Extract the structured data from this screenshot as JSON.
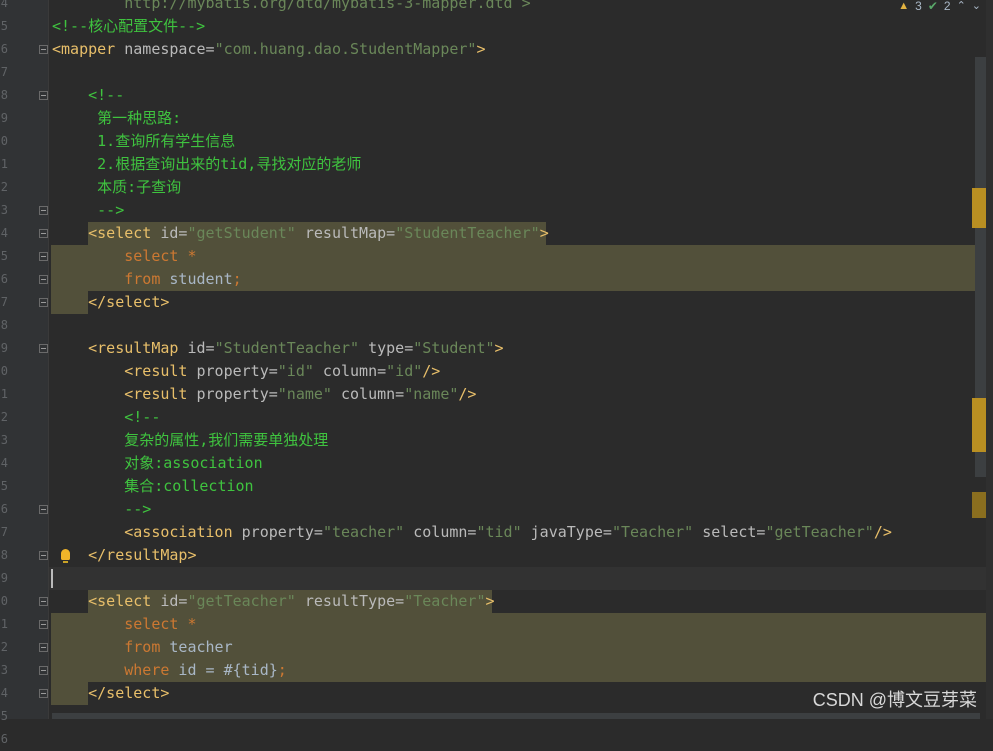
{
  "inspections": {
    "warnings": "3",
    "ok": "2",
    "warning_icon": "warning-triangle-icon",
    "ok_icon": "double-check-icon"
  },
  "line_numbers": [
    "4",
    "5",
    "6",
    "7",
    "8",
    "9",
    "0",
    "1",
    "2",
    "3",
    "4",
    "5",
    "6",
    "7",
    "8",
    "9",
    "0",
    "1",
    "2",
    "3",
    "4",
    "5",
    "6",
    "7",
    "8",
    "9",
    "0",
    "1",
    "2",
    "3",
    "4",
    "5",
    "6"
  ],
  "lines": [
    [
      {
        "t": "url",
        "v": "        http://mybatis.org/dtd/mybatis-3-mapper.dtd >"
      }
    ],
    [
      {
        "t": "comment",
        "v": "<!--核心配置文件-->"
      }
    ],
    [
      {
        "t": "tag",
        "v": "<mapper"
      },
      {
        "t": "attr",
        "v": " namespace="
      },
      {
        "t": "val",
        "v": "\"com.huang.dao.StudentMapper\""
      },
      {
        "t": "tag",
        "v": ">"
      }
    ],
    [],
    [
      {
        "t": "comment",
        "v": "    <!--"
      }
    ],
    [
      {
        "t": "comment",
        "v": "     第一种思路:"
      }
    ],
    [
      {
        "t": "comment",
        "v": "     1.查询所有学生信息"
      }
    ],
    [
      {
        "t": "comment",
        "v": "     2.根据查询出来的tid,寻找对应的老师"
      }
    ],
    [
      {
        "t": "comment",
        "v": "     本质:子查询"
      }
    ],
    [
      {
        "t": "comment",
        "v": "     -->"
      }
    ],
    [
      {
        "t": "tag",
        "v": "    <select"
      },
      {
        "t": "attr",
        "v": " id="
      },
      {
        "t": "val",
        "v": "\"getStudent\""
      },
      {
        "t": "attr",
        "v": " resultMap="
      },
      {
        "t": "val",
        "v": "\"StudentTeacher\""
      },
      {
        "t": "tag",
        "v": ">"
      }
    ],
    [
      {
        "t": "kw",
        "v": "        select"
      },
      {
        "t": "plain",
        "v": " "
      },
      {
        "t": "kw",
        "v": "*"
      }
    ],
    [
      {
        "t": "kw",
        "v": "        from"
      },
      {
        "t": "plain",
        "v": " student"
      },
      {
        "t": "kw",
        "v": ";"
      }
    ],
    [
      {
        "t": "tag",
        "v": "    </select>"
      }
    ],
    [],
    [
      {
        "t": "tag",
        "v": "    <resultMap"
      },
      {
        "t": "attr",
        "v": " id="
      },
      {
        "t": "val",
        "v": "\"StudentTeacher\""
      },
      {
        "t": "attr",
        "v": " type="
      },
      {
        "t": "val",
        "v": "\"Student\""
      },
      {
        "t": "tag",
        "v": ">"
      }
    ],
    [
      {
        "t": "tag",
        "v": "        <result"
      },
      {
        "t": "attr",
        "v": " property="
      },
      {
        "t": "val",
        "v": "\"id\""
      },
      {
        "t": "attr",
        "v": " column="
      },
      {
        "t": "val",
        "v": "\"id\""
      },
      {
        "t": "tag",
        "v": "/>"
      }
    ],
    [
      {
        "t": "tag",
        "v": "        <result"
      },
      {
        "t": "attr",
        "v": " property="
      },
      {
        "t": "val",
        "v": "\"name\""
      },
      {
        "t": "attr",
        "v": " column="
      },
      {
        "t": "val",
        "v": "\"name\""
      },
      {
        "t": "tag",
        "v": "/>"
      }
    ],
    [
      {
        "t": "comment",
        "v": "        <!--"
      }
    ],
    [
      {
        "t": "comment",
        "v": "        复杂的属性,我们需要单独处理"
      }
    ],
    [
      {
        "t": "comment",
        "v": "        对象:association"
      }
    ],
    [
      {
        "t": "comment",
        "v": "        集合:collection"
      }
    ],
    [
      {
        "t": "comment",
        "v": "        -->"
      }
    ],
    [
      {
        "t": "tag",
        "v": "        <association"
      },
      {
        "t": "attr",
        "v": " property="
      },
      {
        "t": "val",
        "v": "\"teacher\""
      },
      {
        "t": "attr",
        "v": " column="
      },
      {
        "t": "val",
        "v": "\"tid\""
      },
      {
        "t": "attr",
        "v": " javaType="
      },
      {
        "t": "val",
        "v": "\"Teacher\""
      },
      {
        "t": "attr",
        "v": " select="
      },
      {
        "t": "val",
        "v": "\"getTeacher\""
      },
      {
        "t": "tag",
        "v": "/>"
      }
    ],
    [
      {
        "t": "tag",
        "v": "    </resultMap>"
      }
    ],
    [],
    [
      {
        "t": "tag",
        "v": "    <select"
      },
      {
        "t": "attr",
        "v": " id="
      },
      {
        "t": "val",
        "v": "\"getTeacher\""
      },
      {
        "t": "attr",
        "v": " resultType="
      },
      {
        "t": "val",
        "v": "\"Teacher\""
      },
      {
        "t": "tag",
        "v": ">"
      }
    ],
    [
      {
        "t": "kw",
        "v": "        select"
      },
      {
        "t": "plain",
        "v": " "
      },
      {
        "t": "kw",
        "v": "*"
      }
    ],
    [
      {
        "t": "kw",
        "v": "        from"
      },
      {
        "t": "plain",
        "v": " teacher"
      }
    ],
    [
      {
        "t": "kw",
        "v": "        where"
      },
      {
        "t": "plain",
        "v": " id = #{tid}"
      },
      {
        "t": "kw",
        "v": ";"
      }
    ],
    [
      {
        "t": "tag",
        "v": "    </select>"
      }
    ],
    [],
    []
  ],
  "watermark": "CSDN @博文豆芽菜"
}
